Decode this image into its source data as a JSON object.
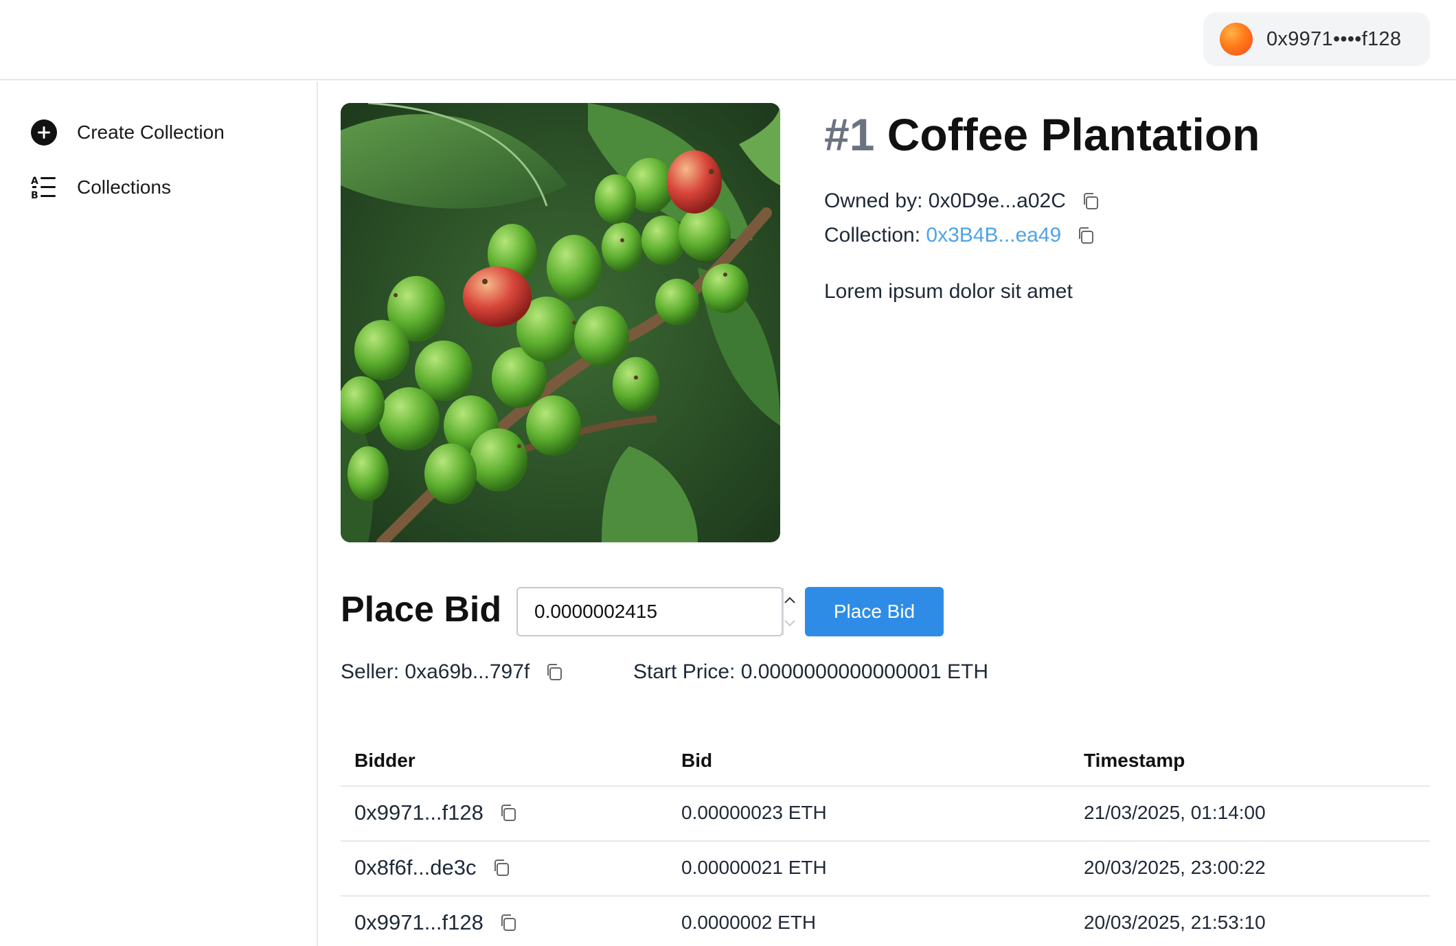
{
  "header": {
    "wallet_address": "0x9971••••f128"
  },
  "sidebar": {
    "items": [
      {
        "label": "Create Collection",
        "icon": "plus-circle-icon"
      },
      {
        "label": "Collections",
        "icon": "list-icon"
      }
    ]
  },
  "nft": {
    "number": "#1",
    "name": "Coffee Plantation",
    "owned_by_label": "Owned by:",
    "owner": "0x0D9e...a02C",
    "collection_label": "Collection:",
    "collection": "0x3B4B...ea49",
    "description": "Lorem ipsum dolor sit amet",
    "image": "coffee-plant-photo"
  },
  "bid": {
    "heading": "Place Bid",
    "input_value": "0.0000002415",
    "button_label": "Place Bid",
    "seller_label": "Seller:",
    "seller": "0xa69b...797f",
    "start_price_label": "Start Price:",
    "start_price": "0.0000000000000001 ETH"
  },
  "bids_table": {
    "columns": [
      "Bidder",
      "Bid",
      "Timestamp"
    ],
    "rows": [
      {
        "bidder": "0x9971...f128",
        "bid": "0.00000023 ETH",
        "timestamp": "21/03/2025, 01:14:00"
      },
      {
        "bidder": "0x8f6f...de3c",
        "bid": "0.00000021 ETH",
        "timestamp": "20/03/2025, 23:00:22"
      },
      {
        "bidder": "0x9971...f128",
        "bid": "0.0000002 ETH",
        "timestamp": "20/03/2025, 21:53:10"
      }
    ]
  },
  "colors": {
    "accent": "#2f8ce6",
    "link": "#4fa3e8",
    "muted_number": "#6b7280"
  }
}
